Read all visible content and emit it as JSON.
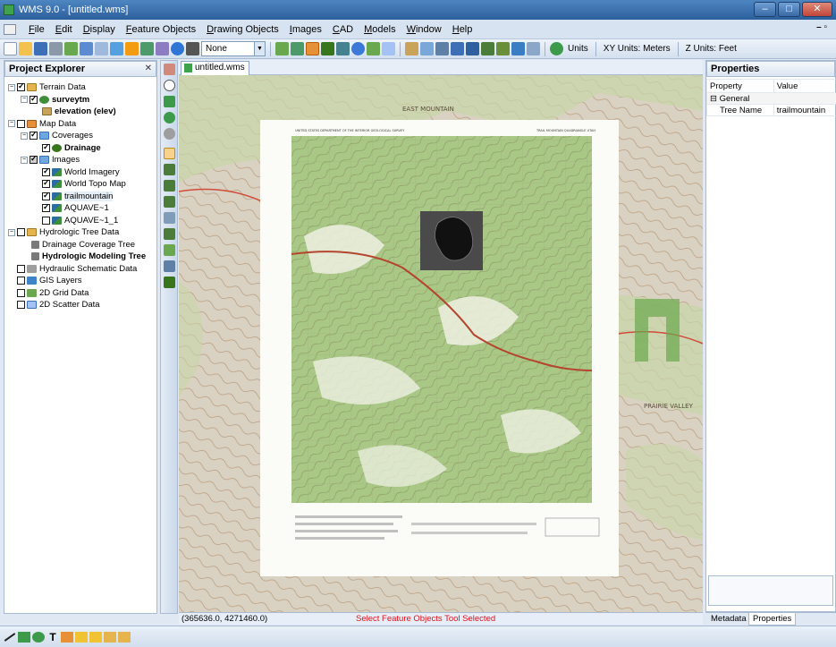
{
  "window": {
    "title": "WMS 9.0 - [untitled.wms]",
    "buttons": {
      "minimize": "–",
      "maximize": "□",
      "close": "✕"
    }
  },
  "menu": {
    "items": [
      "File",
      "Edit",
      "Display",
      "Feature Objects",
      "Drawing Objects",
      "Images",
      "CAD",
      "Models",
      "Window",
      "Help"
    ]
  },
  "toolbar": {
    "mode_select": "None",
    "units_button": "Units",
    "xy_units": "XY Units: Meters",
    "z_units": "Z Units: Feet"
  },
  "explorer": {
    "title": "Project Explorer",
    "close": "✕",
    "tree": [
      {
        "label": "Terrain Data",
        "checked": true,
        "bold": false
      },
      {
        "label": "surveytm",
        "checked": true,
        "bold": true
      },
      {
        "label": "elevation (elev)",
        "checked": null,
        "bold": true
      },
      {
        "label": "Map Data",
        "checked": false,
        "bold": false
      },
      {
        "label": "Coverages",
        "checked": true,
        "bold": false
      },
      {
        "label": "Drainage",
        "checked": true,
        "bold": true
      },
      {
        "label": "Images",
        "checked": true,
        "bold": false
      },
      {
        "label": "World Imagery",
        "checked": true,
        "bold": false
      },
      {
        "label": "World Topo Map",
        "checked": true,
        "bold": false
      },
      {
        "label": "trailmountain",
        "checked": true,
        "bold": false
      },
      {
        "label": "AQUAVE~1",
        "checked": true,
        "bold": false
      },
      {
        "label": "AQUAVE~1_1",
        "checked": false,
        "bold": false
      },
      {
        "label": "Hydrologic Tree Data",
        "checked": false,
        "bold": false
      },
      {
        "label": "Drainage Coverage Tree",
        "checked": null,
        "bold": false
      },
      {
        "label": "Hydrologic Modeling Tree",
        "checked": null,
        "bold": true
      },
      {
        "label": "Hydraulic Schematic Data",
        "checked": false,
        "bold": false
      },
      {
        "label": "GIS Layers",
        "checked": false,
        "bold": false
      },
      {
        "label": "2D Grid Data",
        "checked": false,
        "bold": false
      },
      {
        "label": "2D Scatter Data",
        "checked": false,
        "bold": false
      }
    ]
  },
  "document": {
    "tab": "untitled.wms",
    "map_labels": {
      "quad_header_left": "UNITED STATES DEPARTMENT OF THE INTERIOR GEOLOGICAL SURVEY",
      "quad_header_right": "TRAIL MOUNTAIN QUADRANGLE UTAH",
      "east_mountain": "EAST MOUNTAIN",
      "prairie_valley": "PRAIRIE VALLEY"
    }
  },
  "status": {
    "coords": "(365636.0, 4271460.0)",
    "message": "Select Feature Objects Tool Selected"
  },
  "properties": {
    "title": "Properties",
    "col_property": "Property",
    "col_value": "Value",
    "group": "General",
    "rows": [
      {
        "name": "Tree Name",
        "value": "trailmountain"
      }
    ],
    "tabs": [
      "Metadata",
      "Properties"
    ]
  }
}
